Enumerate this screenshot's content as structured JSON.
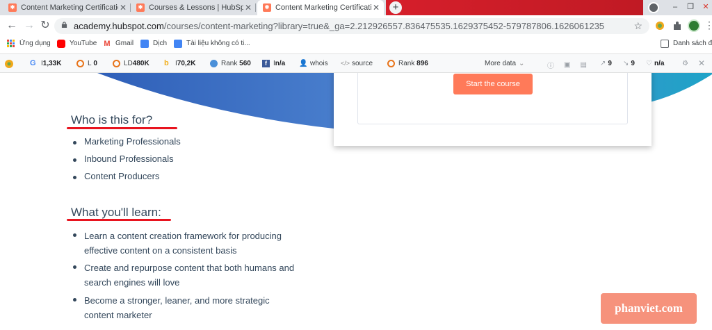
{
  "browser": {
    "tabs": [
      {
        "title": "Content Marketing Certification Co",
        "favicon": "hubspot-icon",
        "active": false
      },
      {
        "title": "Courses & Lessons | HubSpot Ac",
        "favicon": "hubspot-icon",
        "active": false
      },
      {
        "title": "Content Marketing Certification Co",
        "favicon": "hubspot-icon",
        "active": true
      }
    ],
    "new_tab_label": "+",
    "window_controls": {
      "minimize": "–",
      "maximize": "❐",
      "close": "✕"
    }
  },
  "address_bar": {
    "host": "academy.hubspot.com",
    "path": "/courses/content-marketing?library=true&_ga=2.212926557.836475535.1629375452-579787806.1626061235"
  },
  "bookmarks": [
    {
      "label": "Ứng dụng",
      "icon": "apps-grid-icon"
    },
    {
      "label": "YouTube",
      "icon": "youtube-icon"
    },
    {
      "label": "Gmail",
      "icon": "gmail-icon"
    },
    {
      "label": "Dịch",
      "icon": "translate-icon"
    },
    {
      "label": "Tài liệu không có ti...",
      "icon": "docs-icon"
    }
  ],
  "bookmarks_right": {
    "label": "Danh sách đọ",
    "icon": "reading-list-icon"
  },
  "seo_toolbar": {
    "items": [
      {
        "icon": "google-icon",
        "label": "I",
        "value": "1,33K"
      },
      {
        "icon": "seoquake-l-icon",
        "label": "L",
        "value": "0"
      },
      {
        "icon": "seoquake-ld-icon",
        "label": "LD",
        "value": "480K"
      },
      {
        "icon": "bing-icon",
        "label": "I",
        "value": "70,2K"
      },
      {
        "icon": "rank-icon",
        "label": "Rank",
        "value": "560"
      },
      {
        "icon": "facebook-icon",
        "label": "I",
        "value": "n/a"
      },
      {
        "icon": "whois-icon",
        "label": "whois",
        "value": ""
      },
      {
        "icon": "source-code-icon",
        "label": "source",
        "value": ""
      },
      {
        "icon": "semrush-rank-icon",
        "label": "Rank",
        "value": "896"
      }
    ],
    "more_data": "More data",
    "right_counts": [
      {
        "icon": "external-links-icon",
        "value": "9"
      },
      {
        "icon": "internal-links-icon",
        "value": "9"
      },
      {
        "icon": "density-icon",
        "value": "n/a"
      }
    ]
  },
  "course": {
    "start_button": "Start the course",
    "who_heading": "Who is this for?",
    "who_items": [
      "Marketing Professionals",
      "Inbound Professionals",
      "Content Producers"
    ],
    "learn_heading": "What you'll learn:",
    "learn_items": [
      {
        "line1": "Learn a content creation framework for producing",
        "line2": "effective content on a consistent basis"
      },
      {
        "line1": "Create and repurpose content that both humans and",
        "line2": "search engines will love"
      },
      {
        "line1": "Become a stronger, leaner, and more strategic",
        "line2": "content marketer"
      }
    ]
  },
  "watermark": "phanviet.com",
  "colors": {
    "accent": "#ff7a59",
    "heading": "#33475b",
    "underline": "#e8141f",
    "hero_blue": "#3f6fc0",
    "hero_teal": "#1fa3c7"
  }
}
